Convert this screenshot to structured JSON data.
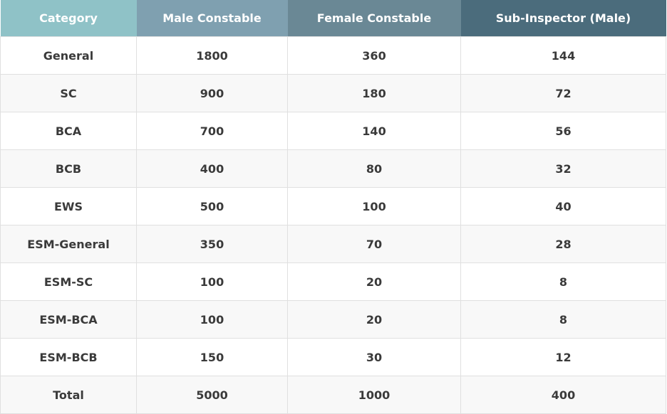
{
  "table": {
    "headers": [
      "Category",
      "Male Constable",
      "Female Constable",
      "Sub-Inspector (Male)"
    ],
    "rows": [
      [
        "General",
        "1800",
        "360",
        "144"
      ],
      [
        "SC",
        "900",
        "180",
        "72"
      ],
      [
        "BCA",
        "700",
        "140",
        "56"
      ],
      [
        "BCB",
        "400",
        "80",
        "32"
      ],
      [
        "EWS",
        "500",
        "100",
        "40"
      ],
      [
        "ESM-General",
        "350",
        "70",
        "28"
      ],
      [
        "ESM-SC",
        "100",
        "20",
        "8"
      ],
      [
        "ESM-BCA",
        "100",
        "20",
        "8"
      ],
      [
        "ESM-BCB",
        "150",
        "30",
        "12"
      ],
      [
        "Total",
        "5000",
        "1000",
        "400"
      ]
    ]
  },
  "colors": {
    "header_col1": "#8fc2c7",
    "header_col2": "#7fa0b0",
    "header_col3": "#6a8895",
    "header_col4": "#4b6c7c",
    "row_alt": "#f8f8f8",
    "text": "#3a3a3a"
  }
}
